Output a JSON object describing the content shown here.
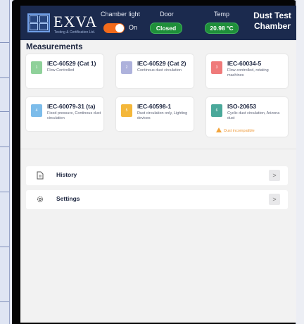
{
  "header": {
    "logo_text": "EXVA",
    "logo_sub": "Testing & Certification Ltd.",
    "chamber_light_label": "Chamber light",
    "chamber_light_state": "On",
    "door_label": "Door",
    "door_state": "Closed",
    "temp_label": "Temp",
    "temp_value": "20.98 °C",
    "title_line1": "Dust Test",
    "title_line2": "Chamber"
  },
  "measurements": {
    "title": "Measurements",
    "cards": [
      {
        "badge": "1",
        "title": "IEC-60529 (Cat 1)",
        "desc": "Flow Controlled",
        "color": "#8fd19a"
      },
      {
        "badge": "2",
        "title": "IEC-60529 (Cat 2)",
        "desc": "Continous dust circulation",
        "color": "#aeb2dc"
      },
      {
        "badge": "3",
        "title": "IEC-60034-5",
        "desc": "Flow-controlled, rotating machines",
        "color": "#ef7a7a"
      },
      {
        "badge": "4",
        "title": "IEC-60079-31 (ta)",
        "desc": "Fixed pressure, Continous dust circulation",
        "color": "#7cbcea"
      },
      {
        "badge": "5",
        "title": "IEC-60598-1",
        "desc": "Dust circulation only, Lighting devices",
        "color": "#f4b73a"
      },
      {
        "badge": "6",
        "title": "ISO-20653",
        "desc": "Cyclic dust circulation, Arizona dust",
        "color": "#4aa89a",
        "warning": "Dust incompatible"
      }
    ]
  },
  "menu": {
    "history_label": "History",
    "settings_label": "Settings",
    "chevron": ">"
  },
  "colors": {
    "header_bg": "#1b2a4e",
    "accent_orange": "#f26a1b",
    "status_green": "#1f8f3a"
  }
}
